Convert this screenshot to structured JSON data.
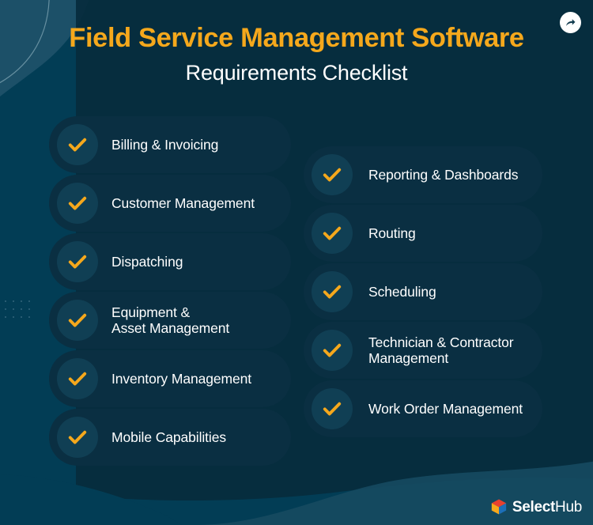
{
  "header": {
    "title": "Field Service Management Software",
    "subtitle": "Requirements Checklist",
    "title_color": "#F5A81C",
    "subtitle_color": "#FFFFFF"
  },
  "share_button": {
    "icon": "share-arrow-icon",
    "label": "Share"
  },
  "theme": {
    "background": "#023D55",
    "card_background": "#0A2F42",
    "circle_background": "#103F54",
    "accent": "#F5A81C",
    "text": "#FFFFFF",
    "decor_light": "#1C5068",
    "decor_dark": "#062B3D"
  },
  "checklist": {
    "left_column": [
      {
        "label": "Billing & Invoicing",
        "icon": "check-icon"
      },
      {
        "label": "Customer Management",
        "icon": "check-icon"
      },
      {
        "label": "Dispatching",
        "icon": "check-icon"
      },
      {
        "label": "Equipment &\nAsset Management",
        "icon": "check-icon"
      },
      {
        "label": "Inventory Management",
        "icon": "check-icon"
      },
      {
        "label": "Mobile Capabilities",
        "icon": "check-icon"
      }
    ],
    "right_column": [
      {
        "label": "Reporting & Dashboards",
        "icon": "check-icon"
      },
      {
        "label": "Routing",
        "icon": "check-icon"
      },
      {
        "label": "Scheduling",
        "icon": "check-icon"
      },
      {
        "label": "Technician & Contractor\nManagement",
        "icon": "check-icon"
      },
      {
        "label": "Work Order Management",
        "icon": "check-icon"
      }
    ]
  },
  "logo": {
    "mark": "selecthub-cube-icon",
    "name_bold": "Select",
    "name_light": "Hub"
  }
}
